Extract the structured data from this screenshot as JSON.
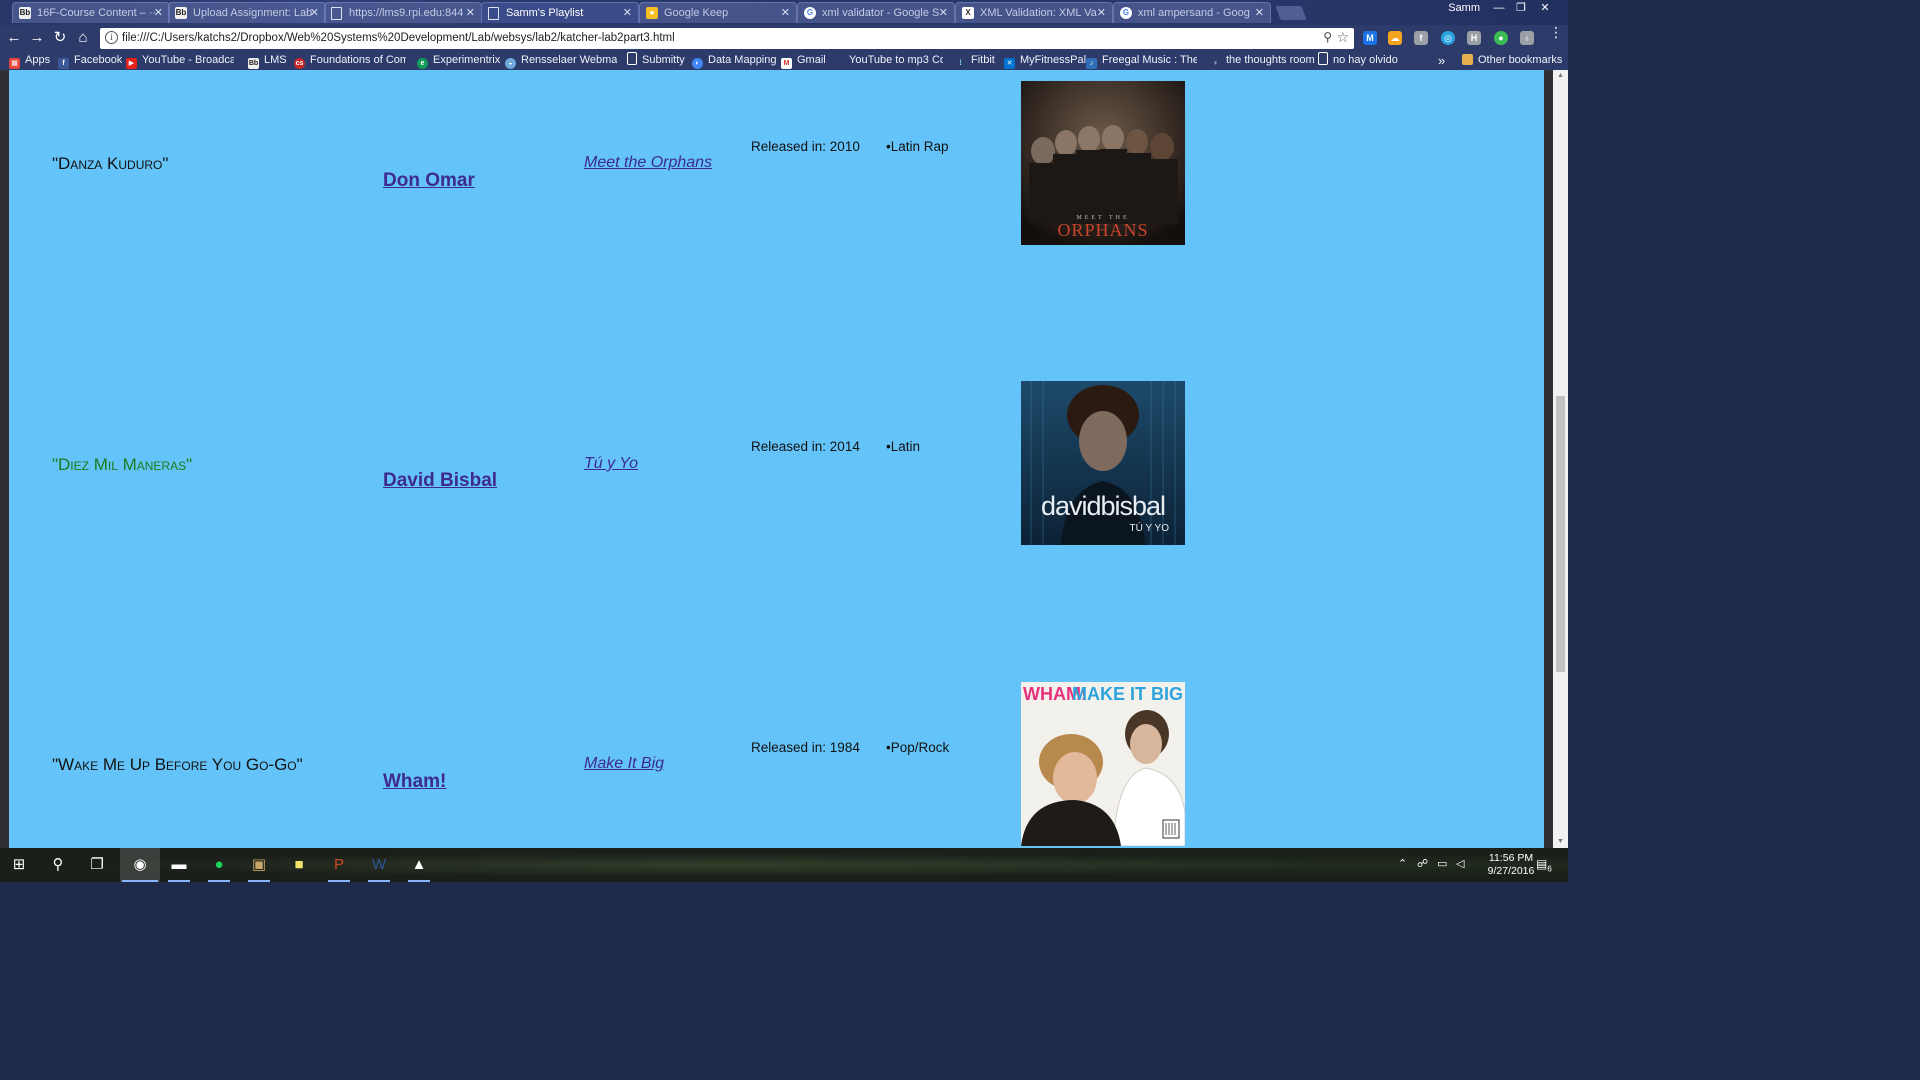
{
  "tabs": [
    {
      "title": "16F-Course Content – ··",
      "favicon": "blackboard-icon"
    },
    {
      "title": "Upload Assignment: Lab",
      "favicon": "blackboard-icon"
    },
    {
      "title": "https://lms9.rpi.edu:844",
      "favicon": "document-icon"
    },
    {
      "title": "Samm's Playlist",
      "favicon": "document-icon",
      "active": true
    },
    {
      "title": "Google Keep",
      "favicon": "keep-icon"
    },
    {
      "title": "xml validator - Google S",
      "favicon": "google-icon"
    },
    {
      "title": "XML Validation: XML Va",
      "favicon": "xml-icon"
    },
    {
      "title": "xml ampersand - Goog",
      "favicon": "google-icon"
    }
  ],
  "profile_name": "Samm",
  "address": {
    "url": "file:///C:/Users/katchs2/Dropbox/Web%20Systems%20Development/Lab/websys/lab2/katcher-lab2part3.html"
  },
  "bookmarks": [
    {
      "label": "Apps",
      "icon": "apps-grid-icon"
    },
    {
      "label": "Facebook",
      "icon": "facebook-icon"
    },
    {
      "label": "YouTube - Broadcast",
      "icon": "youtube-icon"
    },
    {
      "label": "LMS",
      "icon": "blackboard-icon"
    },
    {
      "label": "Foundations of Comp",
      "icon": "cs-icon"
    },
    {
      "label": "Experimentrix",
      "icon": "experimentrix-icon"
    },
    {
      "label": "Rensselaer Webmail",
      "icon": "webmail-icon"
    },
    {
      "label": "Submitty",
      "icon": "document-icon"
    },
    {
      "label": "Data Mapping",
      "icon": "data-mapping-icon"
    },
    {
      "label": "Gmail",
      "icon": "gmail-icon"
    },
    {
      "label": "YouTube to mp3 Con",
      "icon": "mp3-icon"
    },
    {
      "label": "Fitbit",
      "icon": "fitbit-icon"
    },
    {
      "label": "MyFitnessPal",
      "icon": "myfitnesspal-icon"
    },
    {
      "label": "Freegal Music : The N",
      "icon": "freegal-icon"
    },
    {
      "label": "the thoughts room",
      "icon": "thoughts-icon"
    },
    {
      "label": "no hay olvido",
      "icon": "document-icon"
    }
  ],
  "bookmarks_overflow": "»",
  "other_bookmarks": "Other bookmarks",
  "songs": [
    {
      "title": "\"Danza Kuduro\"",
      "artist": "Don Omar",
      "album": "Meet the Orphans",
      "released": "Released in: 2010",
      "genre": "•Latin Rap",
      "cover_text": "MEET THE",
      "cover_title": "ORPHANS"
    },
    {
      "title": "\"Diez Mil Maneras\"",
      "artist": "David Bisbal",
      "album": "Tú y Yo",
      "released": "Released in: 2014",
      "genre": "•Latin",
      "cover_text": "davidbisbal",
      "cover_title": "TÚ Y YO"
    },
    {
      "title": "\"Wake Me Up Before You Go-Go\"",
      "artist": "Wham!",
      "album": "Make It Big",
      "released": "Released in: 1984",
      "genre": "•Pop/Rock",
      "cover_text": "WHAM!",
      "cover_title": "MAKE IT BIG"
    }
  ],
  "taskbar": {
    "apps": [
      "windows-start-icon",
      "search-icon",
      "task-view-icon",
      "chrome-icon",
      "file-explorer-icon",
      "spotify-icon",
      "app-icon",
      "sticky-notes-icon",
      "powerpoint-icon",
      "word-icon",
      "photos-icon"
    ],
    "time": "11:56 PM",
    "date": "9/27/2016",
    "notifications": "6"
  },
  "colors": {
    "page_background": "#64c4fa",
    "link": "#3d2a8f",
    "green_title": "#1a7c1f"
  }
}
